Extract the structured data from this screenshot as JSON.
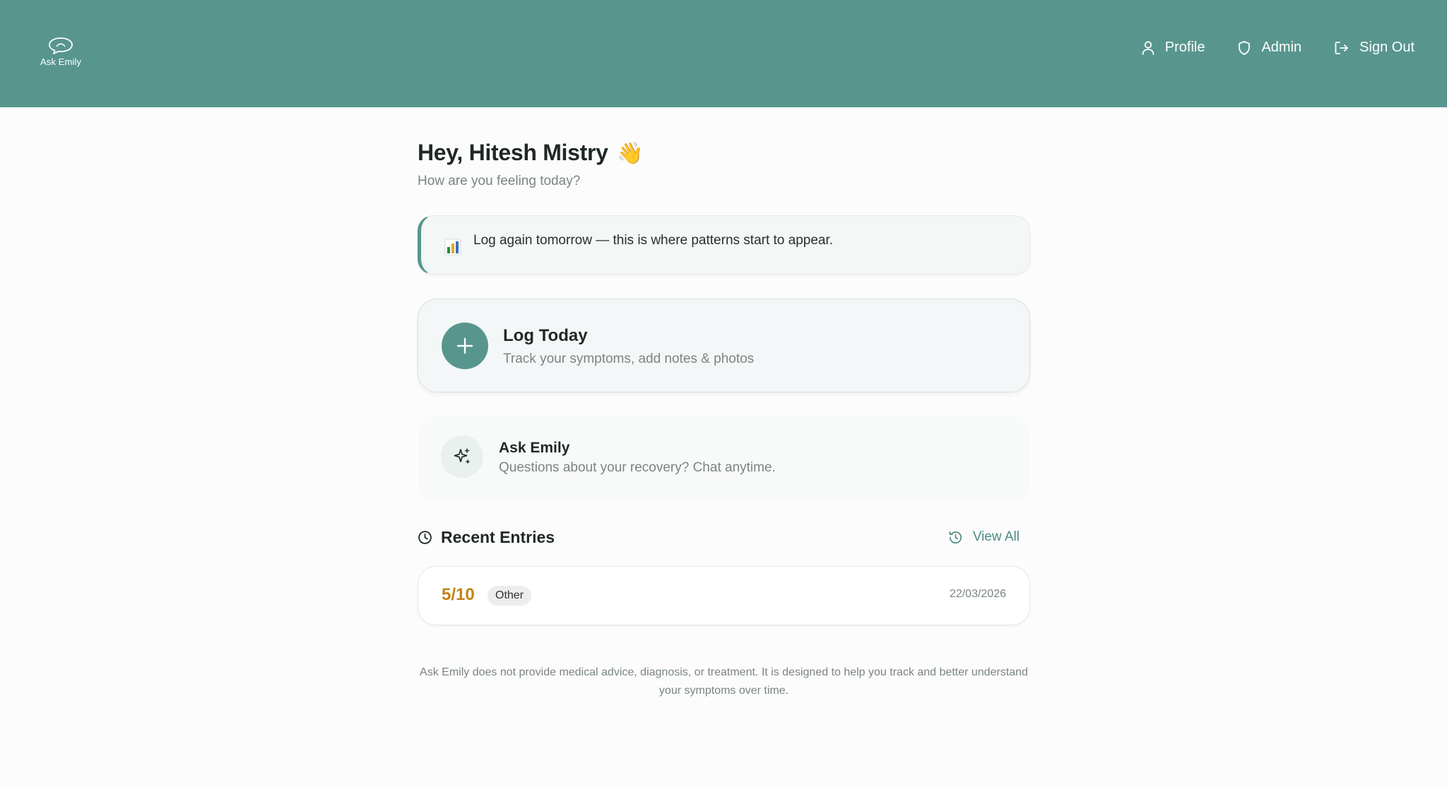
{
  "brand": {
    "name": "Ask Emily"
  },
  "nav": {
    "profile": "Profile",
    "admin": "Admin",
    "sign_out": "Sign Out"
  },
  "greeting": {
    "title": "Hey, Hitesh Mistry",
    "wave": "👋",
    "subtitle": "How are you feeling today?"
  },
  "banner": {
    "icon": "bar-chart-icon",
    "text": "Log again tomorrow — this is where patterns start to appear."
  },
  "log_today": {
    "title": "Log Today",
    "subtitle": "Track your symptoms, add notes & photos"
  },
  "ask_emily": {
    "title": "Ask Emily",
    "subtitle": "Questions about your recovery? Chat anytime."
  },
  "recent": {
    "title": "Recent Entries",
    "view_all": "View All",
    "entries": [
      {
        "score": "5/10",
        "tag": "Other",
        "date": "22/03/2026"
      }
    ]
  },
  "disclaimer": "Ask Emily does not provide medical advice, diagnosis, or treatment. It is designed to help you track and better understand your symptoms over time.",
  "colors": {
    "header": "#58968d",
    "accent": "#58968d",
    "score": "#c48315"
  }
}
